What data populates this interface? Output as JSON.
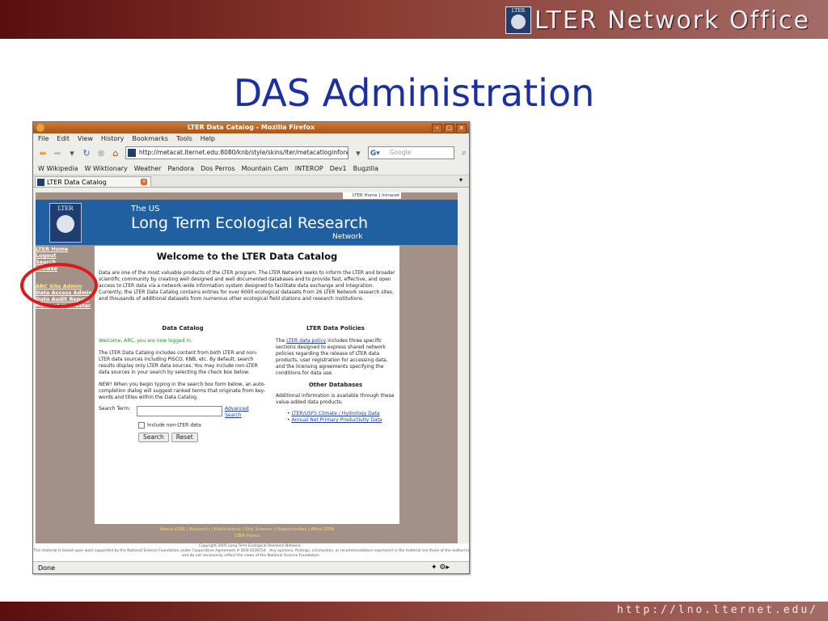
{
  "slide": {
    "brand": "LTER Network Office",
    "brand_logo_text": "LTER",
    "title": "DAS Administration",
    "footer_url": "http://lno.lternet.edu/"
  },
  "browser": {
    "window_title": "LTER Data Catalog - Mozilla Firefox",
    "menu": [
      "File",
      "Edit",
      "View",
      "History",
      "Bookmarks",
      "Tools",
      "Help"
    ],
    "url": "http://metacat.lternet.edu:8080/knb/style/skins/lter/metacatloginforw",
    "search_placeholder": "Google",
    "bookmarks": [
      "Wikipedia",
      "Wiktionary",
      "Weather",
      "Pandora",
      "Dos Perros",
      "Mountain Cam",
      "INTEROP",
      "Dev1",
      "Bugzilla"
    ],
    "tab_label": "LTER Data Catalog",
    "status": "Done"
  },
  "page": {
    "top_links": "LTER Home | Intranet",
    "banner": {
      "logo_text": "LTER",
      "line1": "The US",
      "line2": "Long Term Ecological Research",
      "line3": "Network"
    },
    "sidebar_main": [
      "LTER Home",
      "Logout",
      "Search",
      "Browse"
    ],
    "sidebar_admin": [
      "ARC Site Admin",
      "Data Access Admin",
      "Data Audit Report",
      "Metacat Harvester"
    ],
    "heading": "Welcome to the LTER Data Catalog",
    "intro": "Data are one of the most valuable products of the LTER program. The LTER Network seeks to inform the LTER and broader scientific community by creating well designed and well documented databases and to provide fast, effective, and open access to LTER data via a network-wide information system designed to facilitate data exchange and integration. Currently, the LTER Data Catalog contains entries for over 6000 ecological datasets from 26 LTER Network research sites, and thousands of additional datasets from numerous other ecological field stations and research institutions.",
    "catalog": {
      "heading": "Data Catalog",
      "welcome": "Welcome, ARC, you are now logged in.",
      "p1": "The LTER Data Catalog includes content from both LTER and non-LTER data sources including PISCO, KNB, etc. By default, search results display only LTER data sources. You may include non-LTER data sources in your search by selecting the check box below.",
      "new_label": "NEW!",
      "p2": " When you begin typing in the search box form below, an auto-completion dialog will suggest ranked terms that originate from key-words and titles within the Data Catalog.",
      "search_label": "Search Term:",
      "advanced": "Advanced Search",
      "checkbox_label": "Include non-LTER data",
      "search_btn": "Search",
      "reset_btn": "Reset"
    },
    "policies": {
      "heading": "LTER Data Policies",
      "pre": "The ",
      "link": "LTER data policy",
      "text": " includes three specific sections designed to express shared network policies regarding the release of LTER data products, user registration for accessing data, and the licensing agreements specifying the conditions for data use.",
      "other_heading": "Other Databases",
      "other_text": "Additional information is available through these value-added data products:",
      "links": [
        "LTER/USFS Climate / Hydrology Data",
        "Annual Net Primary Productivity Data"
      ]
    },
    "footer_links": "About LTER | Research | Publications | Site Science | Opportunities | More LTER",
    "footer_home": "LTER Home",
    "copyright": "Copyright 2005 Long Term Ecological Research Network -",
    "support": "This material is based upon work supported by the National Science Foundation under Cooperative Agreement # DEB-0236154 . Any opinions, findings, conclusions, or recommendations expressed in the material are those of the author(s) and do not necessarily reflect the views of the National Science Foundation."
  },
  "colors": {
    "slide_title": "#1c2fa0",
    "banner": "#2060a0",
    "highlight_circle": "#e01818"
  }
}
